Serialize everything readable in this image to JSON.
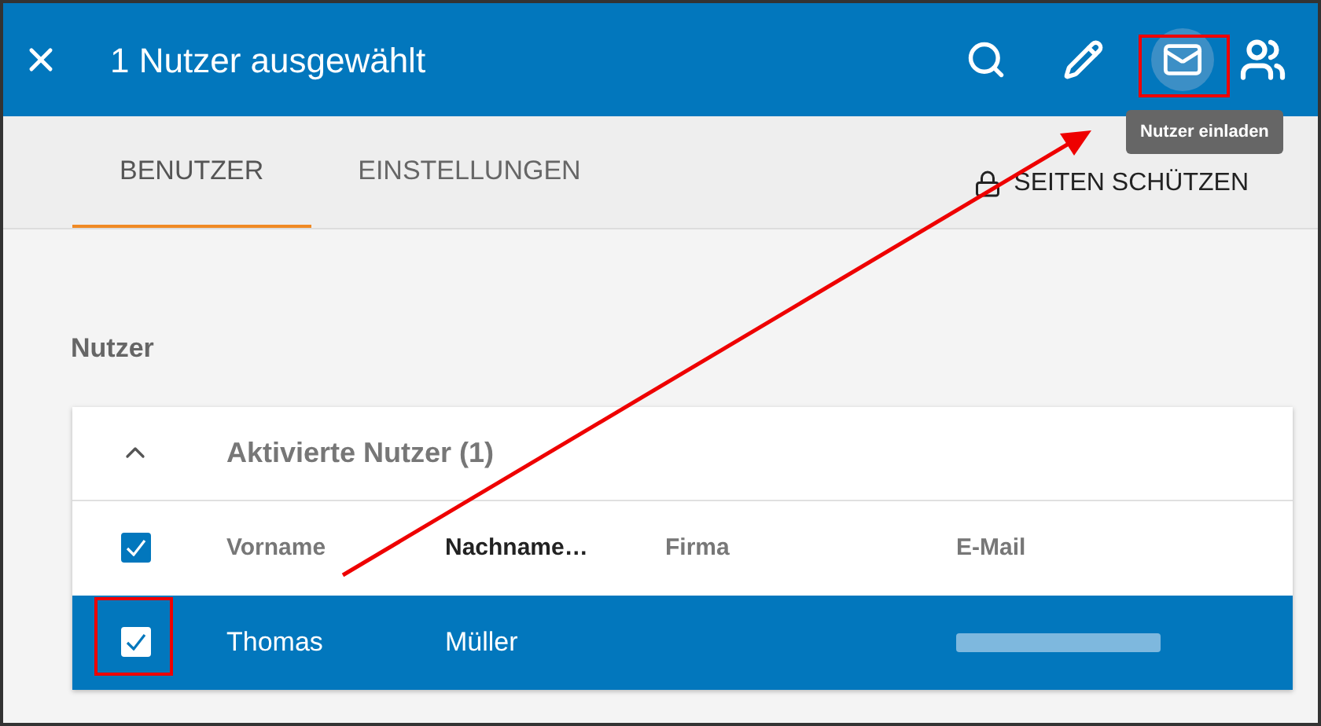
{
  "app_bar": {
    "title": "1 Nutzer ausgewählt"
  },
  "tooltip": "Nutzer einladen",
  "tabs": [
    {
      "label": "BENUTZER",
      "selected": true
    },
    {
      "label": "EINSTELLUNGEN",
      "selected": false
    }
  ],
  "protect_button": "SEITEN SCHÜTZEN",
  "section_title": "Nutzer",
  "group": {
    "title": "Aktivierte Nutzer (1)",
    "expanded": true
  },
  "table": {
    "select_all_checked": true,
    "columns": [
      {
        "label": "Vorname",
        "sorted": false
      },
      {
        "label": "Nachname…",
        "sorted": true
      },
      {
        "label": "Firma",
        "sorted": false
      },
      {
        "label": "E-Mail",
        "sorted": false
      }
    ],
    "rows": [
      {
        "selected": true,
        "cells": [
          "Thomas",
          "Müller",
          ""
        ]
      }
    ]
  }
}
